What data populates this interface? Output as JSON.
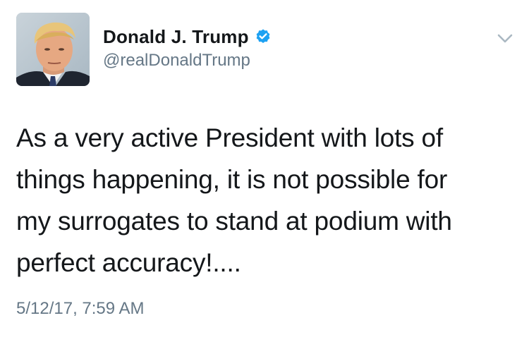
{
  "tweet": {
    "author": {
      "display_name": "Donald J. Trump",
      "handle": "@realDonaldTrump",
      "verified": true,
      "verified_icon": "verified-badge-icon",
      "avatar_icon": "avatar-photo"
    },
    "text_lines": [
      "As a very active President with lots of",
      "things happening, it is not possible for",
      "my surrogates to stand at podium with",
      "perfect accuracy!...."
    ],
    "timestamp": "5/12/17, 7:59 AM",
    "menu_icon": "chevron-down-icon"
  },
  "colors": {
    "text_primary": "#14171a",
    "text_secondary": "#657786",
    "verified_blue": "#1da1f2",
    "caret_gray": "#aab8c2"
  }
}
